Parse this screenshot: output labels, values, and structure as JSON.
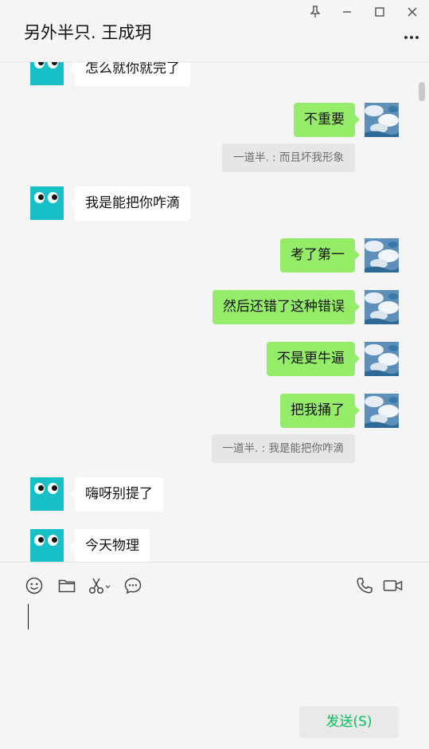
{
  "header": {
    "title": "另外半只. 王成玥"
  },
  "messages": [
    {
      "side": "left",
      "text": "怎么就你就完了"
    },
    {
      "side": "right",
      "text": "不重要"
    },
    {
      "side": "quote",
      "text": "一道半. : 而且坏我形象"
    },
    {
      "side": "left",
      "text": "我是能把你咋滴"
    },
    {
      "side": "right",
      "text": "考了第一"
    },
    {
      "side": "right",
      "text": "然后还错了这种错误"
    },
    {
      "side": "right",
      "text": "不是更牛逼"
    },
    {
      "side": "right",
      "text": "把我捅了"
    },
    {
      "side": "quote",
      "text": "一道半. : 我是能把你咋滴"
    },
    {
      "side": "left",
      "text": "嗨呀别提了"
    },
    {
      "side": "left",
      "text": "今天物理"
    }
  ],
  "input": {
    "value": "",
    "send_label": "发送(S)"
  },
  "colors": {
    "own_bubble": "#95ec69",
    "other_bubble": "#ffffff",
    "avatar_bg": "#17bfc6",
    "send_text": "#07c160"
  }
}
